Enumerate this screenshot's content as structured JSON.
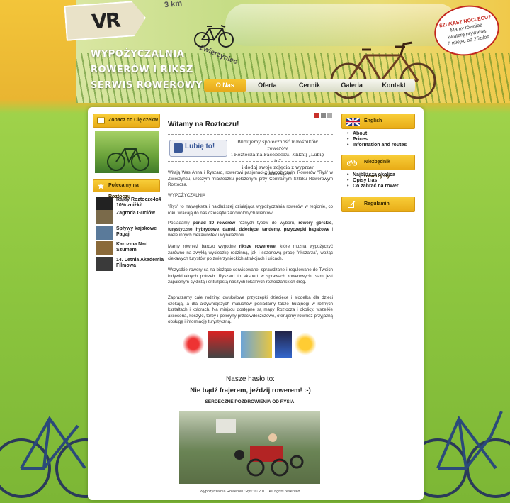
{
  "header": {
    "logo_text": "VR",
    "sign_text": "3 km",
    "sign_zwierz": "Zwierzyniec",
    "brand_lines": [
      "WYPOŻYCZALNIA",
      "ROWERÓW I RIKSZ",
      "SERWIS ROWEROWY"
    ],
    "promo": {
      "title": "SZUKASZ NOCLEGU?",
      "lines": [
        "Mamy również",
        "kwaterę prywatną,",
        "6 miejsc od 25zł/os"
      ]
    }
  },
  "nav": {
    "items": [
      "O Nas",
      "Oferta",
      "Cennik",
      "Galeria",
      "Kontakt"
    ],
    "active": "O Nas"
  },
  "left_sidebar": {
    "see_label": "Zobacz co Cię czeka!",
    "recommend_label": "Polecamy na Roztoczu",
    "recommend_items": [
      "Rajdy Roztocze4x4 10% zniżki!",
      "Zagroda Guciów",
      "Spływy kajakowe Pagaj",
      "Karczma Nad Szumem",
      "14. Letnia Akademia Filmowa"
    ]
  },
  "content": {
    "title": "Witamy na Roztoczu!",
    "fb_button": "Lubię to!",
    "fb_text_lines": [
      "Budujemy społeczność miłośników rowerów",
      "i Roztocza na Facebooku. Kliknij „Lubię to”",
      "i dodaj swoje zdjęcia z wypraw rowerowych!"
    ],
    "para_welcome": "Witają Was Anna i Ryszard, rowerowi pasjonaci z Wypożyczalni Rowerów \"Ryś\" w Zwierzyńcu, uroczym miasteczku położonym przy Centralnym Szlaku Rowerowym Roztocza.",
    "section_heading": "WYPOŻYCZALNIA",
    "para_intro": "\"Ryś\" to największa i najdłuższej działająca wypożyczalnia rowerów w regionie, co roku wracają do nas dziesiątki zadowolonych klientów.",
    "para_fleet": {
      "text1": "Posiadamy ",
      "bold1": "ponad 80 rowerów",
      "text2": " różnych typów do wyboru, ",
      "bold2": "rowery górskie",
      "text3": ", ",
      "bold3": "turystyczne",
      "text4": ", ",
      "bold4": "hybrydowe",
      "text5": ", ",
      "bold5": "damki",
      "text6": ", ",
      "bold6": "dziecięce",
      "text7": ", ",
      "bold7": "tandemy",
      "text8": ", ",
      "bold8": "przyczepki bagażowe",
      "text9": " i wiele innych ciekawostek i wynalazków."
    },
    "para_rickshaw": {
      "text1": "Mamy również bardzo wygodne ",
      "bold1": "riksze rowerowe",
      "text2": ", które można wypożyczyć zarówno na zwykłą wycieczkę rodzinną, jak i sezonową pracę \"rikszarza\", wożąc ciekawych turystów po zwierzynieckich atrakcjach i ulicach."
    },
    "para_service": "Wszystkie rowery są na bieżąco serwisowane, sprawdzane i regulowane do Twoich indywidualnych potrzeb. Ryszard to ekspert w sprawach rowerowych, sam jest zapalonym cyklistą i entuzjastą naszych lokalnych roztoczańskich dróg.",
    "para_family": "Zapraszamy całe rodziny, dwukołowe przyczepki dziecięce i siodełka dla dzieci czekają, a dla aktywniejszych maluchów posiadamy także hulajnogi w różnych kształtach i kolorach. Na miejscu dostępne są mapy Roztocza i okolicy, wszelkie akcesoria, koszyki, torby i peleryny przeciwdeszczowe, oferujemy również przyjazną obsługę i informację turystyczną.",
    "motto": "Nasze hasło to:",
    "slogan": "Nie bądź frajerem, jeździj rowerem! :-)",
    "greeting": "SERDECZNE POZDROWIENIA OD RYSIA!",
    "footer": "Wypożyczalnia Rowerów \"Ryś\" © 2011. All rights reserved."
  },
  "right_sidebar": {
    "lang_label": "English",
    "lang_links": [
      "About",
      "Prices",
      "Information and routes"
    ],
    "guide_label": "Niezbędnik rowerzysty",
    "guide_links": [
      "Najbliższa okolica",
      "Opisy tras",
      "Co zabrać na rower"
    ],
    "rules_label": "Regulamin"
  },
  "colors": {
    "accent_yellow": "#f6c52f",
    "background_green": "#8dc63f",
    "facebook_blue": "#3b5998",
    "promo_red": "#c3281f"
  }
}
